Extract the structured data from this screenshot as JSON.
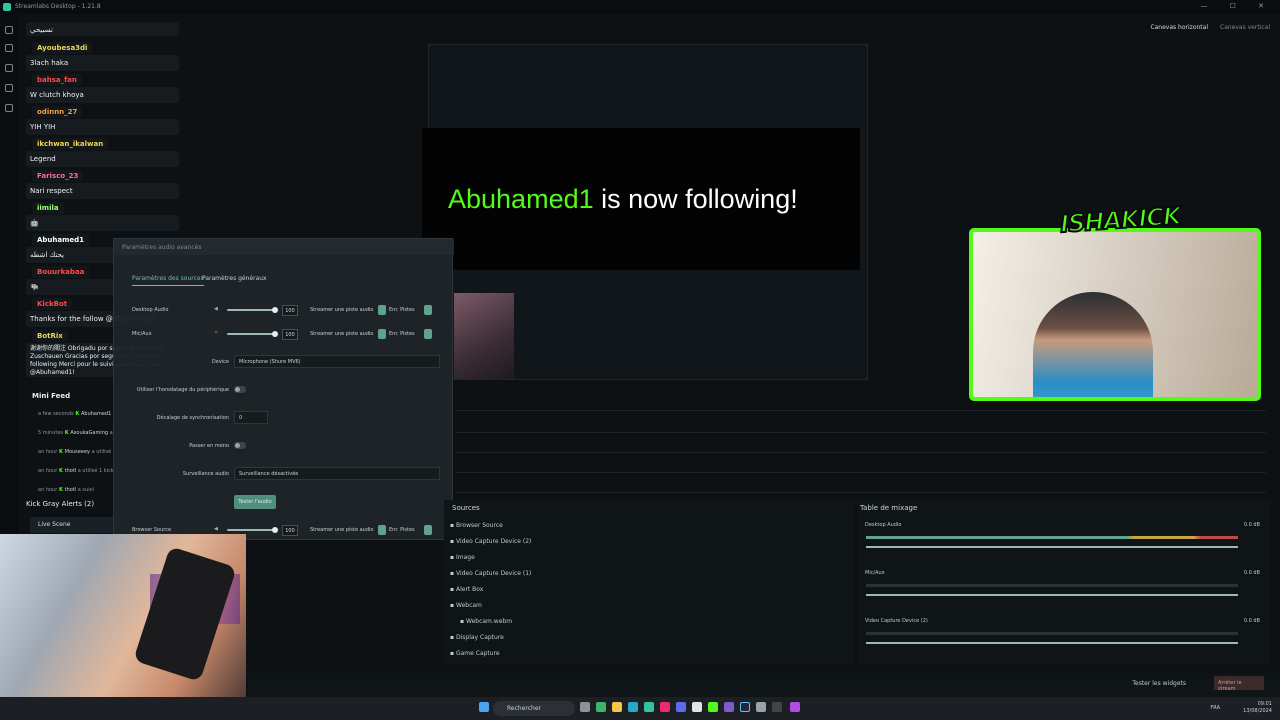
{
  "window": {
    "title": "Streamlabs Desktop - 1.21.8",
    "controls": "— ☐ ✕"
  },
  "canvas": {
    "horizontal": "Canevas horizontal",
    "vertical": "Canevas vertical"
  },
  "chat": {
    "first_message": "تسبيحي",
    "messages": [
      {
        "user": "Ayoubesa3di",
        "color": "#f0d55a",
        "text": "3lach haka"
      },
      {
        "user": "bahsa_fan",
        "color": "#ff4a4a",
        "text": "W clutch khoya"
      },
      {
        "user": "odinnn_27",
        "color": "#f0a040",
        "text": "YIH YIH"
      },
      {
        "user": "ikchwan_ikalwan",
        "color": "#f0d55a",
        "text": "Legend"
      },
      {
        "user": "Farisco_23",
        "color": "#ff6b9a",
        "text": "Nari respect"
      },
      {
        "user": "iimila",
        "color": "#9dff7a",
        "text": "🤖"
      },
      {
        "user": "Abuhamed1",
        "color": "#ffffff",
        "text": "يحتك اشطه"
      },
      {
        "user": "Bouurkabaa",
        "color": "#ff4a4a",
        "text": "🐃"
      },
      {
        "user": "KickBot",
        "color": "#ff4a4a",
        "text": "Thanks for the follow @Abuhamed1"
      },
      {
        "user": "BotRix",
        "color": "#f0d55a",
        "text": "谢谢你的關注 Obrigadu por seguir Danke fürs Zuschauen Gracias por seguirme Thanks for following Merci pour le suivi شكرا على المتابعة @Abuhamed1!"
      }
    ]
  },
  "minifeed": {
    "title": "Mini Feed",
    "rows": [
      {
        "time": "a few seconds",
        "user": "Abuhamed1",
        "action": ""
      },
      {
        "time": "5 minutes",
        "user": "AsoukaGaming",
        "action": "a"
      },
      {
        "time": "an hour",
        "user": "Mouseeey",
        "action": "a utilisé"
      },
      {
        "time": "an hour",
        "user": "thotl",
        "action": "a utilisé 1 kick"
      },
      {
        "time": "an hour",
        "user": "thotl",
        "action": "a suivi"
      }
    ]
  },
  "kick_alerts": {
    "label": "Kick Gray Alerts (2)",
    "scene": "Live Scene"
  },
  "audio_dialog": {
    "header": "Paramètres audio avancés",
    "tabs": [
      "Paramètres des sources",
      "Paramètres généraux"
    ],
    "rows": [
      {
        "name": "Desktop Audio",
        "value": "100",
        "stream": "Streamer une piste audio",
        "rec": "Enr. Pistes"
      },
      {
        "name": "Mic/Aux",
        "value": "100",
        "stream": "Streamer une piste audio",
        "rec": "Enr. Pistes"
      },
      {
        "name": "Browser Source",
        "value": "100",
        "stream": "Streamer une piste audio",
        "rec": "Enr. Pistes"
      }
    ],
    "device_label": "Device",
    "device_value": "Microphone (Shure MV6)",
    "use_device_timestamps": "Utiliser l'horodatage du périphérique",
    "sync_offset_label": "Décalage de synchronisation",
    "sync_offset_value": "0",
    "mono_label": "Passer en mono",
    "monitor_label": "Surveillance audio",
    "monitor_value": "Surveillance désactivée",
    "test_button": "Tester l'audio"
  },
  "alert": {
    "name": "Abuhamed1",
    "text": " is now following!"
  },
  "overlay_logo": "ISHAKICK",
  "sources": {
    "title": "Sources",
    "items": [
      "Browser Source",
      "Video Capture Device (2)",
      "Image",
      "Video Capture Device (1)",
      "Alert Box",
      "Webcam",
      "Webcam.webm",
      "Display Capture",
      "Game Capture"
    ]
  },
  "mixer": {
    "title": "Table de mixage",
    "channels": [
      {
        "name": "Desktop Audio",
        "db": "0.0 dB",
        "level": 1.0
      },
      {
        "name": "Mic/Aux",
        "db": "0.0 dB",
        "level": 1.0
      },
      {
        "name": "Video Capture Device (2)",
        "db": "0.0 dB",
        "level": 1.0
      }
    ]
  },
  "bottom": {
    "test_widgets": "Tester les widgets",
    "end_stream": "Arrêter le stream"
  },
  "taskbar": {
    "search": "Rechercher",
    "lang": "FRA",
    "time": "09:01",
    "date": "13/08/2024"
  },
  "colors": {
    "accent": "#53fc18",
    "teal": "#31c3a2"
  }
}
